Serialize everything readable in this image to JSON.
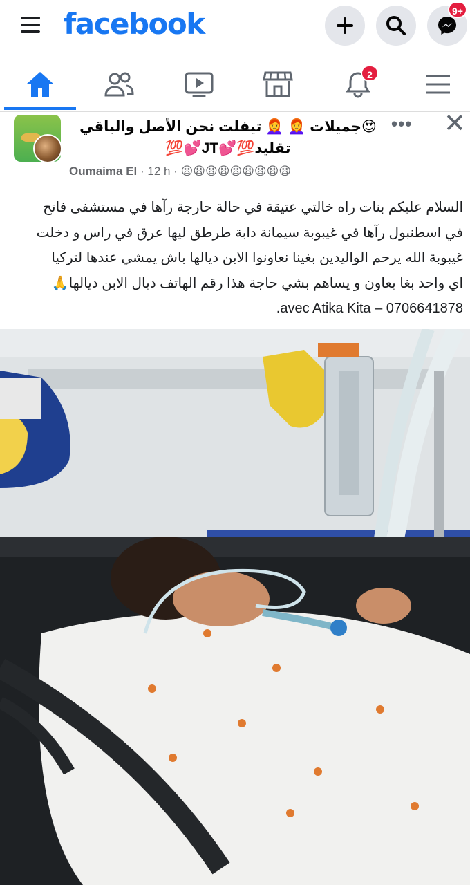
{
  "app": {
    "logo": "facebook"
  },
  "topbar": {
    "menu_icon": "hamburger-menu-icon",
    "add_icon": "plus-icon",
    "search_icon": "search-icon",
    "messenger_icon": "messenger-icon",
    "messenger_badge": "9+"
  },
  "tabs": [
    {
      "name": "home",
      "icon": "home-icon",
      "active": true
    },
    {
      "name": "friends",
      "icon": "friends-icon",
      "active": false
    },
    {
      "name": "watch",
      "icon": "video-icon",
      "active": false
    },
    {
      "name": "marketplace",
      "icon": "marketplace-icon",
      "active": false
    },
    {
      "name": "notifications",
      "icon": "bell-icon",
      "active": false,
      "badge": "2"
    },
    {
      "name": "menu",
      "icon": "menu-icon",
      "active": false
    }
  ],
  "post": {
    "group_title_line1": "😍جميلات 👩‍🦰 👩‍🦰 تيفلت نحن الأصل والباقي",
    "group_title_line2": "تقليد💯💕JT💕💯",
    "author": "Oumaima El",
    "separator": " · ",
    "time": "12 h",
    "separator2": " · ",
    "emoji_row": "😫😫😫😫😫😫😫😫😫",
    "text_lines": [
      "السلام عليكم بنات راه خالتي عتيقة في حالة حارجة رآها في مستشفى فاتح",
      "في اسطنبول رآها  في غيبوبة سيمانة دابة طرطق ليها عرق في راس و دخلت",
      "غيبوبة الله يرحم الواليدين بغينا نعاونوا الابن ديالها باش يمشي عندها لتركيا",
      "اي واحد بغا يعاون و يساهم بشي حاجة هذا رقم الهاتف ديال الابن ديالها🙏",
      "0706641878 – avec Atika Kita."
    ]
  },
  "colors": {
    "brand": "#1877f2",
    "badge": "#e41e3f",
    "icon_gray": "#606770",
    "button_bg": "#e4e6eb"
  }
}
